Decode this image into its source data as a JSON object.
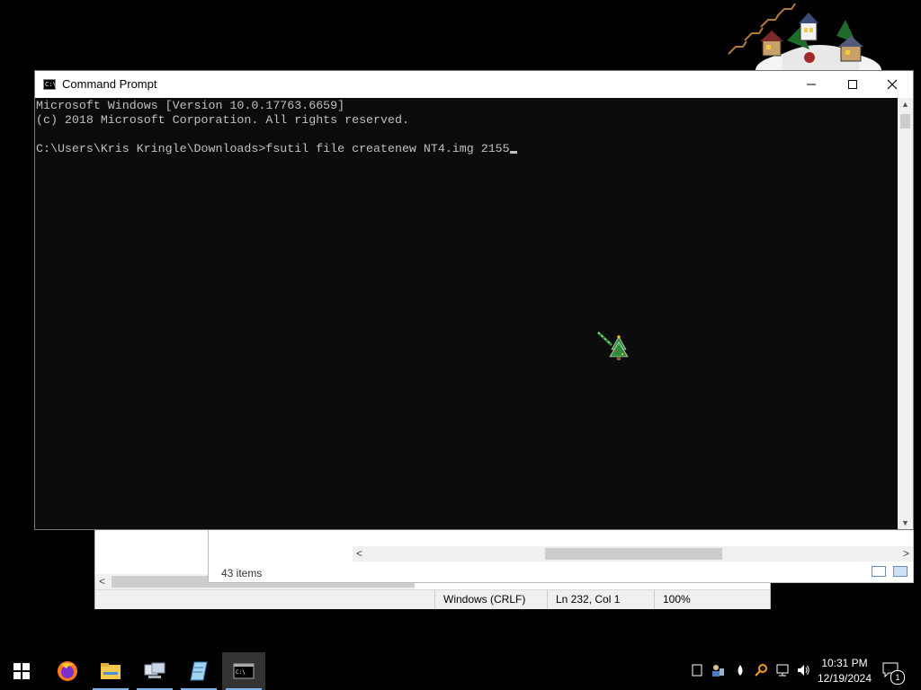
{
  "desktop": {
    "decoration": "christmas-village-reindeer"
  },
  "cmd_window": {
    "title": "Command Prompt",
    "console_lines": [
      "Microsoft Windows [Version 10.0.17763.6659]",
      "(c) 2018 Microsoft Corporation. All rights reserved.",
      "",
      "C:\\Users\\Kris Kringle\\Downloads>fsutil file createnew NT4.img 2155"
    ],
    "text_color": "#c0c0c0",
    "background": "#0c0c0c"
  },
  "explorer_window": {
    "status_items": "43 items"
  },
  "notepad_window": {
    "status_eol": "Windows (CRLF)",
    "status_position": "Ln 232, Col 1",
    "status_zoom": "100%"
  },
  "taskbar": {
    "apps": [
      {
        "name": "start-icon"
      },
      {
        "name": "firefox-icon"
      },
      {
        "name": "file-explorer-icon"
      },
      {
        "name": "network-computer-icon"
      },
      {
        "name": "notepad-icon"
      },
      {
        "name": "command-prompt-icon",
        "active": true
      }
    ],
    "tray_icons": [
      "tablet-icon",
      "user-network-icon",
      "water-drop-icon",
      "search-key-icon",
      "network-icon",
      "volume-icon"
    ],
    "time": "10:31 PM",
    "date": "12/19/2024",
    "notification_count": "1"
  }
}
